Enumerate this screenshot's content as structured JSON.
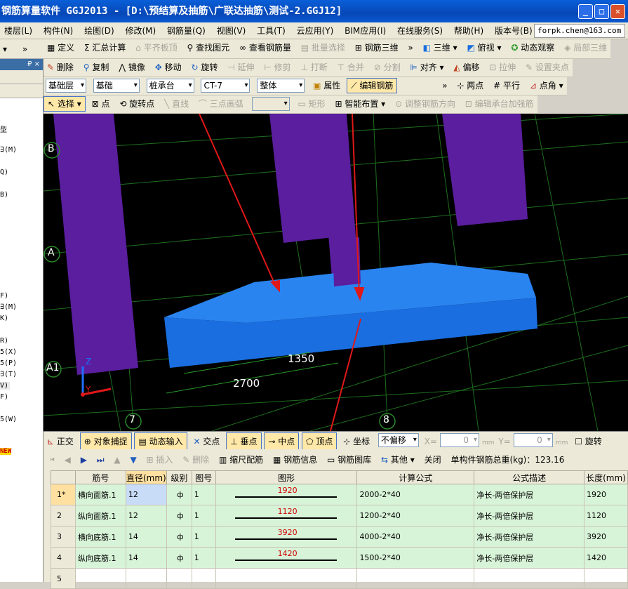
{
  "window": {
    "title": "钢筋算量软件 GGJ2013 - [D:\\预结算及抽筋\\广联达抽筋\\测试-2.GGJ12]"
  },
  "menu": {
    "items": [
      "楼层(L)",
      "构件(N)",
      "绘图(D)",
      "修改(M)",
      "钢筋量(Q)",
      "视图(V)",
      "工具(T)",
      "云应用(Y)",
      "BIM应用(I)",
      "在线服务(S)",
      "帮助(H)",
      "版本号(B)"
    ],
    "user": "forpk.chen@163.com"
  },
  "left_panel": {
    "header": "₽ ×",
    "items": [
      "型",
      "∃(M)",
      "Q)",
      "B)",
      "F)",
      "∃(M)",
      "K)",
      "R)",
      "5(X)",
      "5(P)",
      "∃(T)",
      "V)",
      "F)",
      "5(W)"
    ],
    "new_badge": "NEW"
  },
  "toolbar1": {
    "define": "定义",
    "sum_calc": "Σ 汇总计算",
    "level_top": "平齐板顶",
    "find": "查找图元",
    "view_rebar": "查看钢筋量",
    "batch_select": "批量选择",
    "rebar_3d": "钢筋三维",
    "view_3d": "三维",
    "top_view": "俯视",
    "dynamic_observe": "动态观察",
    "local_3d": "局部三维"
  },
  "toolbar2": {
    "delete": "删除",
    "copy": "复制",
    "mirror": "镜像",
    "move": "移动",
    "rotate": "旋转",
    "extend": "延伸",
    "trim": "修剪",
    "break": "打断",
    "merge": "合并",
    "split": "分割",
    "align": "对齐",
    "offset": "偏移",
    "stretch": "拉伸",
    "set_clip": "设置夹点"
  },
  "toolbar3": {
    "floor": "基础层",
    "category": "基础",
    "type": "桩承台",
    "name": "CT-7",
    "scope": "整体",
    "property": "属性",
    "edit_rebar": "编辑钢筋",
    "two_points": "两点",
    "parallel": "平行",
    "point_angle": "点角"
  },
  "toolbar4": {
    "select": "选择",
    "point": "点",
    "rotate_point": "旋转点",
    "line": "直线",
    "arc": "三点画弧",
    "rect": "矩形",
    "smart_place": "智能布置",
    "adjust_dir": "调整钢筋方向",
    "edit_cap": "编辑承台加强筋"
  },
  "viewport": {
    "axis_b": "B",
    "axis_a": "A",
    "axis_a1": "A1",
    "axis_7": "7",
    "axis_8": "8",
    "dim_1350": "1350",
    "dim_2700": "2700",
    "z_label": "Z",
    "y_label": "Y"
  },
  "statusbar": {
    "ortho": "正交",
    "snap": "对象捕捉",
    "dyn_input": "动态输入",
    "intersect": "交点",
    "perp": "垂点",
    "mid": "中点",
    "vertex": "顶点",
    "coord": "坐标",
    "no_offset": "不偏移",
    "x_label": "X=",
    "x_val": "0",
    "mm1": "mm",
    "y_label": "Y=",
    "y_val": "0",
    "mm2": "mm",
    "rotate": "旋转"
  },
  "rebar_toolbar": {
    "insert": "插入",
    "delete": "删除",
    "scale": "缩尺配筋",
    "info": "钢筋信息",
    "library": "钢筋图库",
    "other": "其他",
    "close": "关闭",
    "total": "单构件钢筋总重(kg)：123.16"
  },
  "table": {
    "headers": [
      "筋号",
      "直径(mm)",
      "级别",
      "图号",
      "图形",
      "计算公式",
      "公式描述",
      "长度(mm)"
    ],
    "rows": [
      {
        "no": "1*",
        "name": "横向面筋.1",
        "dia": "12",
        "grade": "ф",
        "fig": "1",
        "shape": "1920",
        "formula": "2000-2*40",
        "desc": "净长-两倍保护层",
        "len": "1920"
      },
      {
        "no": "2",
        "name": "纵向面筋.1",
        "dia": "12",
        "grade": "ф",
        "fig": "1",
        "shape": "1120",
        "formula": "1200-2*40",
        "desc": "净长-两倍保护层",
        "len": "1120"
      },
      {
        "no": "3",
        "name": "横向底筋.1",
        "dia": "14",
        "grade": "ф",
        "fig": "1",
        "shape": "3920",
        "formula": "4000-2*40",
        "desc": "净长-两倍保护层",
        "len": "3920"
      },
      {
        "no": "4",
        "name": "纵向底筋.1",
        "dia": "14",
        "grade": "ф",
        "fig": "1",
        "shape": "1420",
        "formula": "1500-2*40",
        "desc": "净长-两倍保护层",
        "len": "1420"
      },
      {
        "no": "5",
        "name": "",
        "dia": "",
        "grade": "",
        "fig": "",
        "shape": "",
        "formula": "",
        "desc": "",
        "len": ""
      }
    ]
  },
  "colors": {
    "column": "#5a1e9e",
    "cap": "#1a6ee0",
    "grid": "#1e6e1e",
    "arrow": "#e01818"
  }
}
